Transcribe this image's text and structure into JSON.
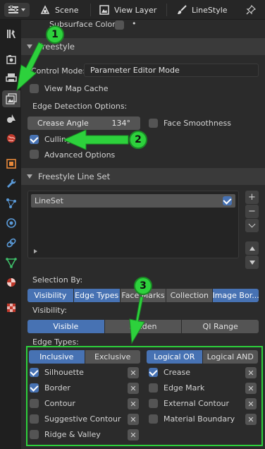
{
  "header": {
    "scene_label": "Scene",
    "view_layer_label": "View Layer",
    "line_style_label": "LineStyle"
  },
  "subsurface": {
    "label": "Subsurface Color",
    "dot": "•"
  },
  "freestyle": {
    "title": "Freestyle",
    "control_mode_label": "Control Mode:",
    "control_mode_value": "Parameter Editor Mode",
    "view_map_cache_label": "View Map Cache",
    "edge_detection_label": "Edge Detection Options:",
    "crease_angle_label": "Crease Angle",
    "crease_angle_value": "134°",
    "face_smoothness_label": "Face Smoothness",
    "culling_label": "Culling",
    "advanced_options_label": "Advanced Options"
  },
  "lineset": {
    "title": "Freestyle Line Set",
    "list_item": "LineSet",
    "selection_by_label": "Selection By:",
    "selection_tabs": [
      "Visibility",
      "Edge Types",
      "Face Marks",
      "Collection",
      "Image Bor..."
    ],
    "visibility_label": "Visibility:",
    "visibility_tabs": [
      "Visible",
      "Hidden",
      "QI Range"
    ],
    "edge_types_label": "Edge Types:",
    "inclusive_label": "Inclusive",
    "exclusive_label": "Exclusive",
    "logical_or_label": "Logical OR",
    "logical_and_label": "Logical AND",
    "left_edges": [
      {
        "label": "Silhouette",
        "checked": true
      },
      {
        "label": "Border",
        "checked": true
      },
      {
        "label": "Contour",
        "checked": false
      },
      {
        "label": "Suggestive Contour",
        "checked": false
      },
      {
        "label": "Ridge & Valley",
        "checked": false
      }
    ],
    "right_edges": [
      {
        "label": "Crease",
        "checked": true
      },
      {
        "label": "Edge Mark",
        "checked": false
      },
      {
        "label": "External Contour",
        "checked": false
      },
      {
        "label": "Material Boundary",
        "checked": false
      }
    ]
  },
  "annotations": {
    "one": "1",
    "two": "2",
    "three": "3"
  },
  "colors": {
    "accent": "#4772b3",
    "callout_green": "#2dd13c",
    "panel_bg": "#2b2b2b"
  }
}
